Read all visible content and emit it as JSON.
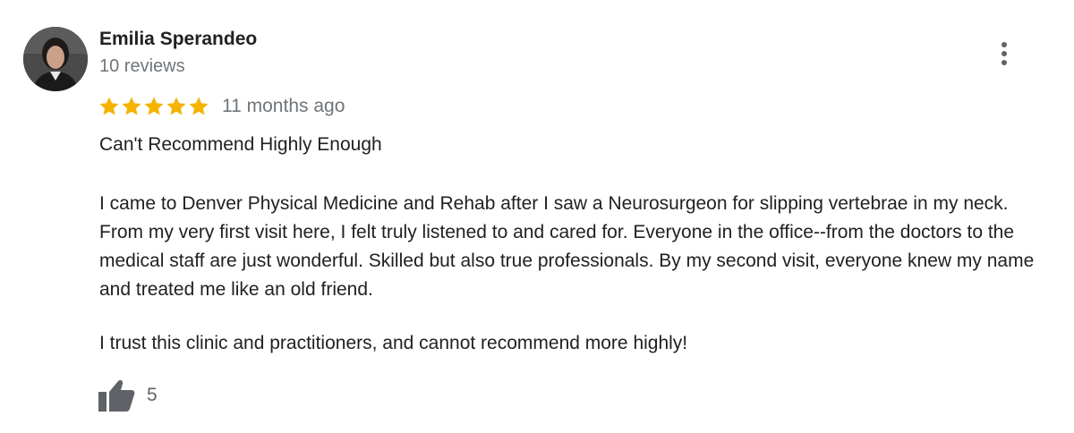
{
  "reviewer": {
    "name": "Emilia Sperandeo",
    "review_count": "10 reviews"
  },
  "rating": {
    "stars": 5,
    "max_stars": 5,
    "star_color": "#f4b400",
    "date": "11 months ago"
  },
  "review": {
    "title": "Can't Recommend Highly Enough",
    "body": "I came to Denver Physical Medicine and Rehab after I saw a Neurosurgeon for slipping vertebrae in my neck. From my very first visit here, I felt truly listened to and cared for. Everyone in the office--from the doctors to the medical staff are just wonderful. Skilled but also true professionals. By my second visit, everyone knew my name and treated me like an old friend.",
    "closing": "I trust this clinic and practitioners, and cannot recommend more highly!"
  },
  "likes": {
    "count": "5"
  },
  "icons": {
    "avatar": "avatar",
    "more": "more-vert-icon",
    "star": "star-icon",
    "like": "thumbs-up-icon"
  }
}
